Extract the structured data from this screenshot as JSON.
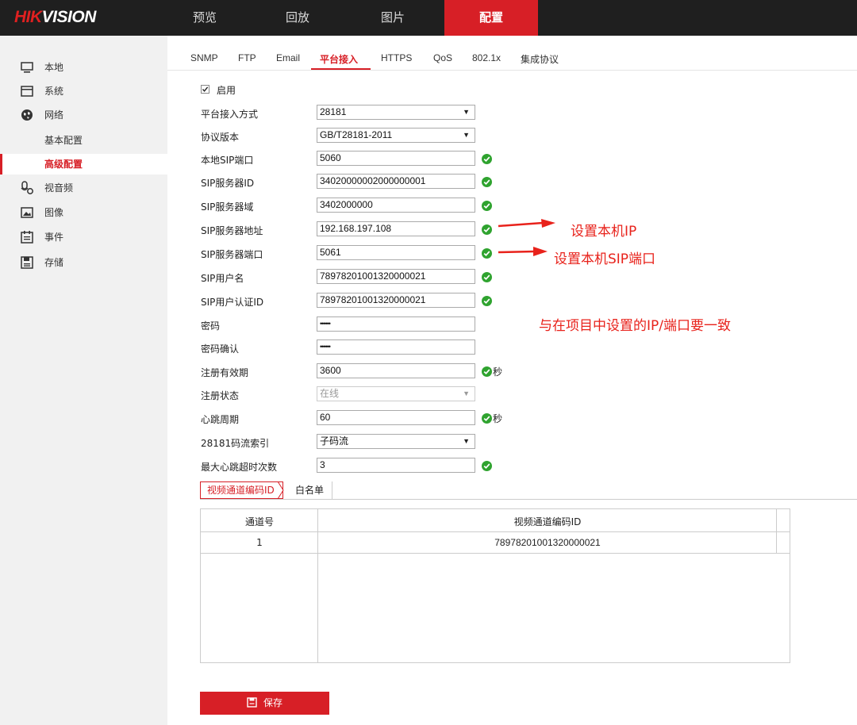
{
  "brand": {
    "hik": "HIK",
    "vision": "VISION"
  },
  "nav": {
    "items": [
      "预览",
      "回放",
      "图片",
      "配置"
    ],
    "active": "配置"
  },
  "sidebar": {
    "items": [
      {
        "label": "本地",
        "icon": "monitor-icon"
      },
      {
        "label": "系统",
        "icon": "system-icon"
      },
      {
        "label": "网络",
        "icon": "globe-icon"
      },
      {
        "label": "基本配置"
      },
      {
        "label": "高级配置"
      },
      {
        "label": "视音频",
        "icon": "mic-camera-icon"
      },
      {
        "label": "图像",
        "icon": "image-icon"
      },
      {
        "label": "事件",
        "icon": "calendar-icon"
      },
      {
        "label": "存储",
        "icon": "save-disk-icon"
      }
    ]
  },
  "subtabs": [
    "SNMP",
    "FTP",
    "Email",
    "平台接入",
    "HTTPS",
    "QoS",
    "802.1x",
    "集成协议"
  ],
  "form": {
    "enable_label": "启用",
    "rows": [
      {
        "label": "平台接入方式",
        "value": "28181",
        "type": "select"
      },
      {
        "label": "协议版本",
        "value": "GB/T28181-2011",
        "type": "select"
      },
      {
        "label": "本地SIP端口",
        "value": "5060",
        "type": "input",
        "valid": true
      },
      {
        "label": "SIP服务器ID",
        "value": "34020000002000000001",
        "type": "input",
        "valid": true
      },
      {
        "label": "SIP服务器域",
        "value": "3402000000",
        "type": "input",
        "valid": true
      },
      {
        "label": "SIP服务器地址",
        "value": "192.168.197.108",
        "type": "input",
        "valid": true
      },
      {
        "label": "SIP服务器端口",
        "value": "5061",
        "type": "input",
        "valid": true
      },
      {
        "label": "SIP用户名",
        "value": "78978201001320000021",
        "type": "input",
        "valid": true
      },
      {
        "label": "SIP用户认证ID",
        "value": "78978201001320000021",
        "type": "input",
        "valid": true
      },
      {
        "label": "密码",
        "value": "••••••",
        "type": "password"
      },
      {
        "label": "密码确认",
        "value": "••••••",
        "type": "password"
      },
      {
        "label": "注册有效期",
        "value": "3600",
        "type": "input",
        "valid": true,
        "unit": "秒"
      },
      {
        "label": "注册状态",
        "value": "在线",
        "type": "select-disabled"
      },
      {
        "label": "心跳周期",
        "value": "60",
        "type": "input",
        "valid": true,
        "unit": "秒"
      },
      {
        "label": "28181码流索引",
        "value": "子码流",
        "type": "select"
      },
      {
        "label": "最大心跳超时次数",
        "value": "3",
        "type": "input",
        "valid": true
      }
    ]
  },
  "annotations": {
    "ip": "设置本机IP",
    "port": "设置本机SIP端口",
    "note": "与在项目中设置的IP/端口要一致"
  },
  "channel_tabs": [
    "视频通道编码ID",
    "白名单"
  ],
  "table": {
    "headers": [
      "通道号",
      "视频通道编码ID"
    ],
    "rows": [
      [
        "1",
        "78978201001320000021"
      ]
    ]
  },
  "save_label": "保存",
  "colors": {
    "accent": "#d71f26",
    "valid": "#2fa32f",
    "annotation": "#e8221b"
  }
}
